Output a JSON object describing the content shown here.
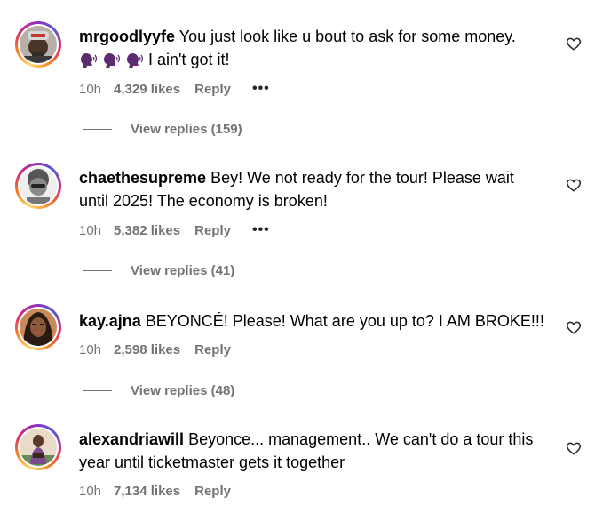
{
  "comments": [
    {
      "username": "mrgoodlyyfe",
      "text_line1": "You just look like u bout to ask for some money.",
      "text_line2": "I ain't got it!",
      "emojis": [
        "speaking-head-emoji",
        "speaking-head-emoji",
        "speaking-head-emoji"
      ],
      "time": "10h",
      "likes": "4,329 likes",
      "reply": "Reply",
      "more": "•••",
      "view_replies": "View replies (159)"
    },
    {
      "username": "chaethesupreme",
      "text_line1": "Bey! We not ready for the tour! Please wait",
      "text_line2": "until 2025! The economy is broken!",
      "time": "10h",
      "likes": "5,382 likes",
      "reply": "Reply",
      "more": "•••",
      "view_replies": "View replies (41)"
    },
    {
      "username": "kay.ajna",
      "text_line1": "BEYONCÉ! Please! What are you up to? I AM BROKE!!!",
      "time": "10h",
      "likes": "2,598 likes",
      "reply": "Reply",
      "view_replies": "View replies (48)"
    },
    {
      "username": "alexandriawill",
      "text_line1": "Beyonce... management.. We can't do a tour this",
      "text_line2": "year until ticketmaster gets it together",
      "time": "10h",
      "likes": "7,134 likes",
      "reply": "Reply"
    }
  ],
  "colors": {
    "meta_gray": "#737373",
    "emoji_purple": "#5b2c6f"
  },
  "icons": {
    "like": "heart-outline-icon",
    "emoji": "speaking-head-emoji"
  }
}
